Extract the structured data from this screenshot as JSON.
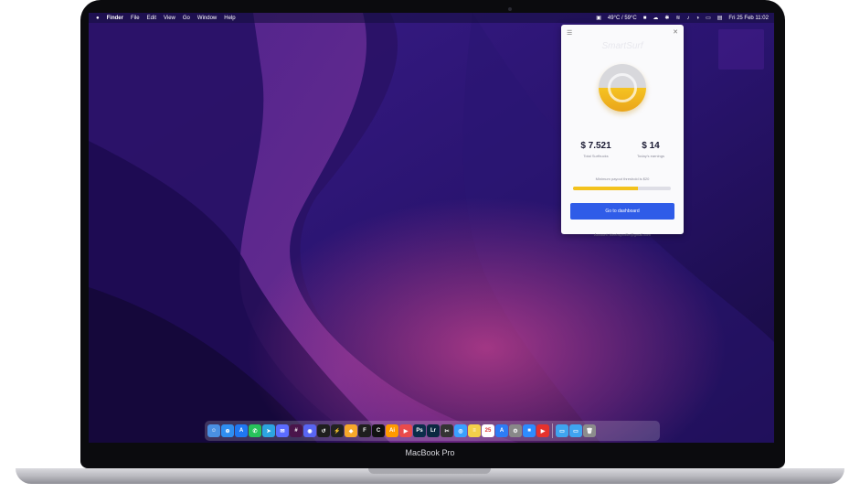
{
  "menubar": {
    "apple_icon": "apple-icon",
    "items": [
      "Finder",
      "File",
      "Edit",
      "View",
      "Go",
      "Window",
      "Help"
    ],
    "weather": "49°C / 59°C",
    "datetime": "Fri 25 Feb  11:02"
  },
  "popup": {
    "brand": "SmartSurf",
    "total_value": "$ 7.521",
    "total_label": "Total Surfbucks",
    "today_value": "$ 14",
    "today_label": "Today's earnings",
    "threshold_text": "Minimum payout threshold is $20",
    "progress": 0.66,
    "button_label": "Go to dashboard",
    "account_text": "Account: bleebsprofile@gmail.com"
  },
  "dock": {
    "apps": [
      {
        "name": "finder-icon",
        "glyph": "☺",
        "color": "#4a90e2"
      },
      {
        "name": "safari-icon",
        "glyph": "⊕",
        "color": "#2f8ef0"
      },
      {
        "name": "appstore-icon",
        "glyph": "A",
        "color": "#1f77f2"
      },
      {
        "name": "whatsapp-icon",
        "glyph": "✆",
        "color": "#27c25b"
      },
      {
        "name": "telegram-icon",
        "glyph": "➤",
        "color": "#2ca4e0"
      },
      {
        "name": "messenger-icon",
        "glyph": "✉",
        "color": "#5b6cff"
      },
      {
        "name": "slack-icon",
        "glyph": "#",
        "color": "#4a154b"
      },
      {
        "name": "discord-icon",
        "glyph": "◉",
        "color": "#5865f2"
      },
      {
        "name": "git-icon",
        "glyph": "↺",
        "color": "#1e1e1e"
      },
      {
        "name": "linear-icon",
        "glyph": "⚡",
        "color": "#222222"
      },
      {
        "name": "sketch-icon",
        "glyph": "◆",
        "color": "#f7a82a"
      },
      {
        "name": "figma-icon",
        "glyph": "F",
        "color": "#1e1e1e"
      },
      {
        "name": "cursor-icon",
        "glyph": "C",
        "color": "#111111"
      },
      {
        "name": "illustrator-icon",
        "glyph": "Ai",
        "color": "#ff9a00"
      },
      {
        "name": "cast-icon",
        "glyph": "▶",
        "color": "#e94b4b"
      },
      {
        "name": "photoshop-icon",
        "glyph": "Ps",
        "color": "#0b2d4a"
      },
      {
        "name": "lightroom-icon",
        "glyph": "Lr",
        "color": "#0a2840"
      },
      {
        "name": "finalcut-icon",
        "glyph": "✂",
        "color": "#333333"
      },
      {
        "name": "screenshot-icon",
        "glyph": "◎",
        "color": "#3aa0ff"
      },
      {
        "name": "notes-icon",
        "glyph": "≡",
        "color": "#f3d04a"
      },
      {
        "name": "calendar-icon",
        "glyph": "25",
        "color": "#ffffff"
      },
      {
        "name": "appstore2-icon",
        "glyph": "A",
        "color": "#2d7cf6"
      },
      {
        "name": "settings-icon",
        "glyph": "⚙",
        "color": "#888888"
      },
      {
        "name": "zoom-icon",
        "glyph": "■",
        "color": "#2d8cff"
      },
      {
        "name": "video-icon",
        "glyph": "▶",
        "color": "#e5322d"
      }
    ],
    "right": [
      {
        "name": "folder-icon",
        "glyph": "▭",
        "color": "#3fa4f0"
      },
      {
        "name": "downloads-icon",
        "glyph": "▭",
        "color": "#3fa4f0"
      },
      {
        "name": "trash-icon",
        "glyph": "🗑",
        "color": "#8c8c8c"
      }
    ]
  },
  "device_label": "MacBook Pro"
}
